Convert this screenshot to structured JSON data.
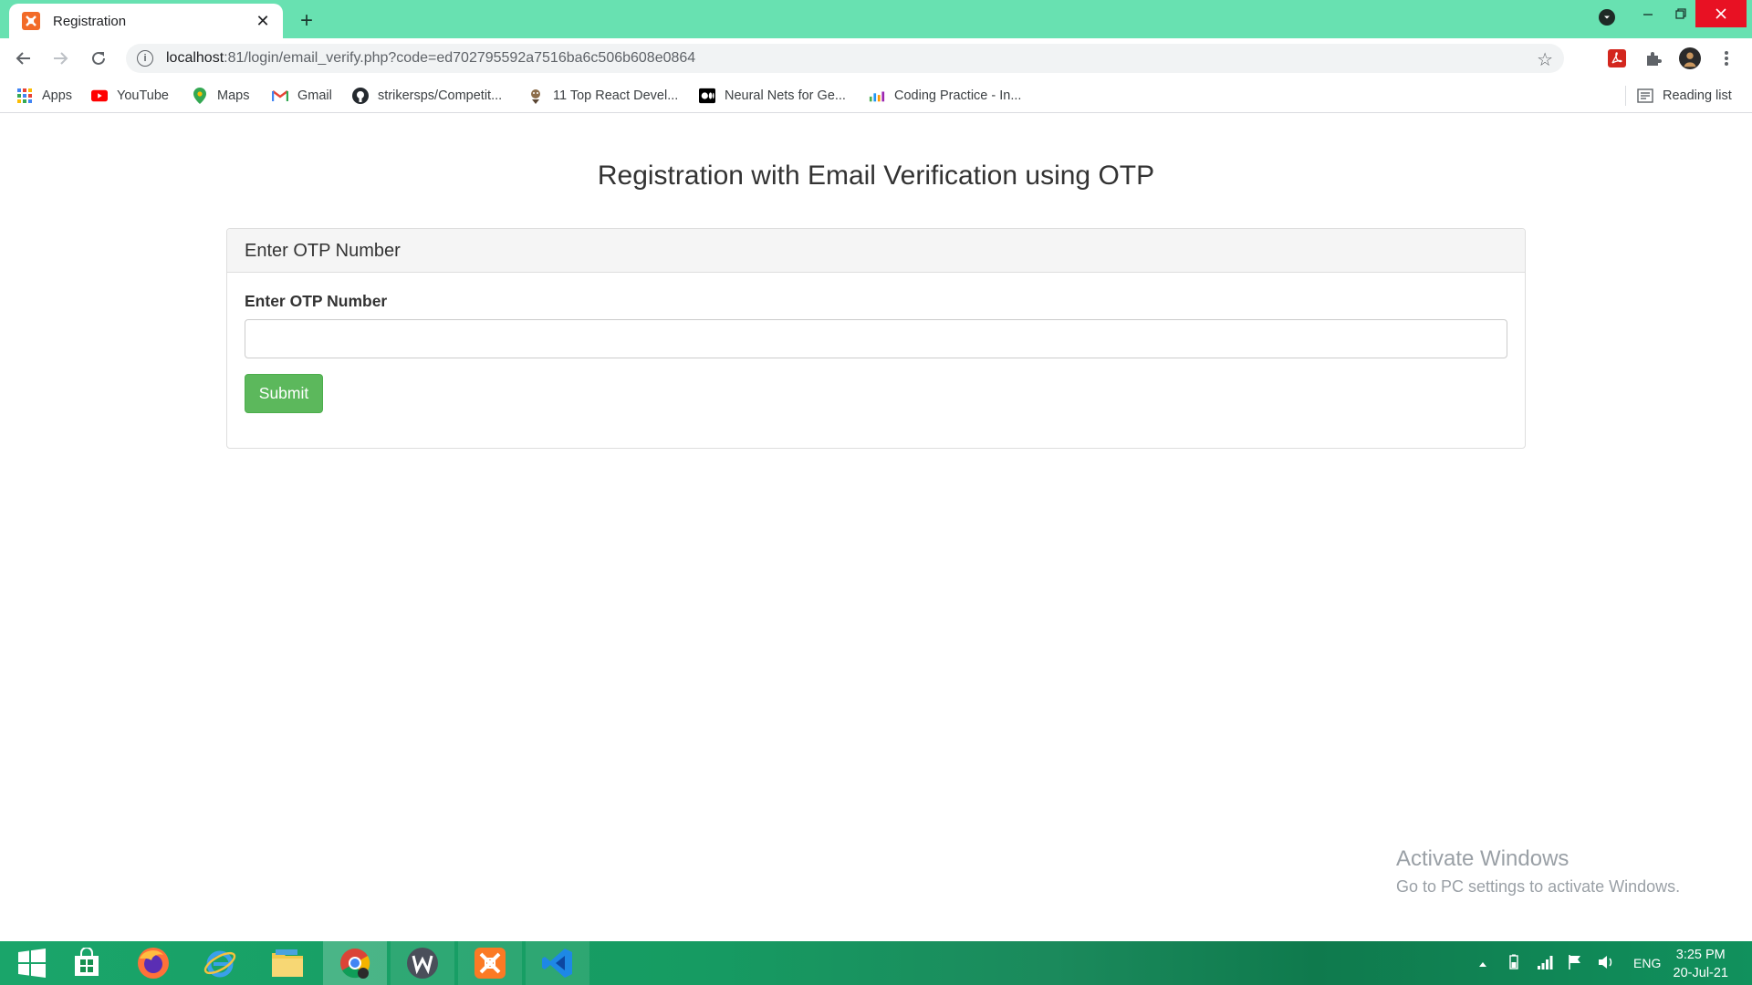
{
  "browser": {
    "tab_title": "Registration",
    "url_host": "localhost",
    "url_rest": ":81/login/email_verify.php?code=ed702795592a7516ba6c506b608e0864",
    "new_tab_symbol": "+",
    "close_tab_symbol": "✕"
  },
  "bookmarks": [
    {
      "label": "Apps",
      "icon": "apps-grid-icon"
    },
    {
      "label": "YouTube",
      "icon": "youtube-icon"
    },
    {
      "label": "Maps",
      "icon": "maps-pin-icon"
    },
    {
      "label": "Gmail",
      "icon": "gmail-icon"
    },
    {
      "label": "strikersps/Competit...",
      "icon": "github-icon"
    },
    {
      "label": "11 Top React Devel...",
      "icon": "react-dev-icon"
    },
    {
      "label": "Neural Nets for Ge...",
      "icon": "medium-icon"
    },
    {
      "label": "Coding Practice - In...",
      "icon": "chart-bars-icon"
    }
  ],
  "reading_list": "Reading list",
  "page": {
    "heading": "Registration with Email Verification using OTP",
    "panel_heading": "Enter OTP Number",
    "otp_label": "Enter OTP Number",
    "otp_value": "",
    "submit_label": "Submit"
  },
  "watermark": {
    "line1": "Activate Windows",
    "line2": "Go to PC settings to activate Windows."
  },
  "taskbar": {
    "apps": [
      "start-icon",
      "store-icon",
      "firefox-icon",
      "internet-explorer-icon",
      "file-explorer-icon",
      "chrome-icon",
      "wamp-icon",
      "xampp-icon",
      "vscode-icon"
    ],
    "language": "ENG",
    "time": "3:25 PM",
    "date": "20-Jul-21"
  },
  "colors": {
    "titlebar": "#68e1b1",
    "submit": "#5cb85c",
    "taskbar": "#169b62"
  }
}
